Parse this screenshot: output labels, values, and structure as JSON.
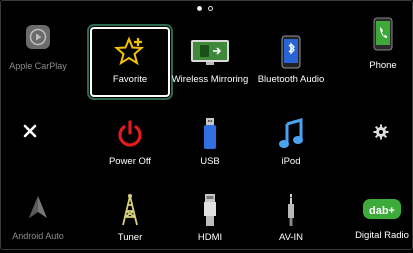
{
  "pager": {
    "pages": 2,
    "current": 1
  },
  "left_column": {
    "carplay": {
      "label": "Apple CarPlay",
      "icon": "carplay-icon"
    },
    "close": {
      "icon": "close-icon"
    },
    "android_auto": {
      "label": "Android Auto",
      "icon": "android-auto-icon"
    }
  },
  "right_column": {
    "phone": {
      "label": "Phone",
      "icon": "phone-icon"
    },
    "settings": {
      "icon": "gear-icon"
    },
    "digital_radio": {
      "label": "Digital Radio",
      "icon": "dab-icon",
      "badge": "dab+"
    }
  },
  "grid": {
    "favorite": {
      "label": "Favorite",
      "icon": "star-plus-icon",
      "selected": true
    },
    "wireless_mirroring": {
      "label": "Wireless Mirroring",
      "icon": "mirroring-icon"
    },
    "bluetooth_audio": {
      "label": "Bluetooth Audio",
      "icon": "bluetooth-audio-icon"
    },
    "power_off": {
      "label": "Power Off",
      "icon": "power-icon"
    },
    "usb": {
      "label": "USB",
      "icon": "usb-icon"
    },
    "ipod": {
      "label": "iPod",
      "icon": "music-note-icon"
    },
    "tuner": {
      "label": "Tuner",
      "icon": "antenna-tower-icon"
    },
    "hdmi": {
      "label": "HDMI",
      "icon": "hdmi-icon"
    },
    "av_in": {
      "label": "AV-IN",
      "icon": "av-jack-icon"
    }
  },
  "colors": {
    "accent_green": "#2d6a4e",
    "favorite_star": "#f2c200",
    "power_red": "#e21b1b"
  }
}
